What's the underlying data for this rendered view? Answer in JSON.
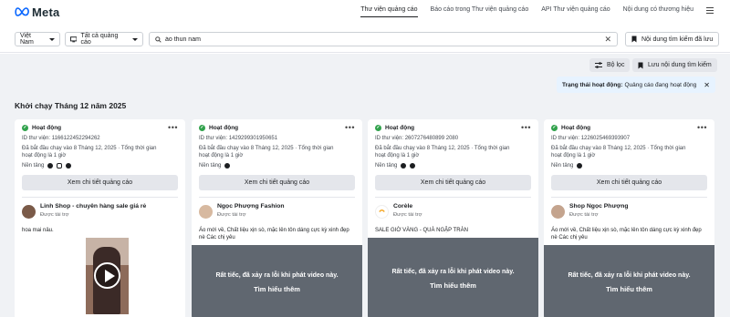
{
  "app": {
    "logo_text": "Meta"
  },
  "nav": {
    "links": [
      {
        "label": "Thư viện quảng cáo",
        "active": true
      },
      {
        "label": "Báo cáo trong Thư viện quảng cáo",
        "active": false
      },
      {
        "label": "API Thư viện quảng cáo",
        "active": false
      },
      {
        "label": "Nội dung có thương hiệu",
        "active": false
      }
    ]
  },
  "filters": {
    "country": "Việt Nam",
    "ad_category": "Tất cả quảng cáo",
    "search_value": "áo thun nam",
    "saved_searches_label": "Nội dung tìm kiếm đã lưu"
  },
  "toolbar": {
    "filter_label": "Bộ lọc",
    "save_search_label": "Lưu nội dung tìm kiếm"
  },
  "status_filter": {
    "label": "Trạng thái hoạt động:",
    "value": "Quảng cáo đang hoạt động"
  },
  "section_title": "Khởi chạy Tháng 12 năm 2025",
  "cards": [
    {
      "status": "Hoạt động",
      "library_id": "ID thư viện: 1166122452294262",
      "started": "Đã bắt đầu chạy vào 8 Tháng 12, 2025 · Tổng thời gian hoạt động là 1 giờ",
      "platforms_label": "Nền tảng",
      "detail_button": "Xem chi tiết quảng cáo",
      "advertiser": "Linh Shop - chuyên hàng sale giá rẻ",
      "sponsored": "Được tài trợ",
      "body": "hoa mai nâu."
    },
    {
      "status": "Hoạt động",
      "library_id": "ID thư viện: 1429299301950651",
      "started": "Đã bắt đầu chạy vào 8 Tháng 12, 2025 · Tổng thời gian hoạt động là 1 giờ",
      "platforms_label": "Nền tảng",
      "detail_button": "Xem chi tiết quảng cáo",
      "advertiser": "Ngọc Phượng Fashion",
      "sponsored": "Được tài trợ",
      "body": "Áo mới về, Chất liệu xịn sò, mặc lên tôn dáng cực kỳ xinh đẹp nè Các chị yêu",
      "error_message": "Rất tiếc, đã xảy ra lỗi khi phát video này.",
      "error_link": "Tìm hiểu thêm"
    },
    {
      "status": "Hoạt động",
      "library_id": "ID thư viện: 2607276480899 2080",
      "started": "Đã bắt đầu chạy vào 8 Tháng 12, 2025 · Tổng thời gian hoạt động là 1 giờ",
      "platforms_label": "Nền tảng",
      "detail_button": "Xem chi tiết quảng cáo",
      "advertiser": "Corèle",
      "sponsored": "Được tài trợ",
      "body": "SALE GIỜ VÀNG - QUÀ NGẬP TRÀN",
      "error_message": "Rất tiếc, đã xảy ra lỗi khi phát video này.",
      "error_link": "Tìm hiểu thêm"
    },
    {
      "status": "Hoạt động",
      "library_id": "ID thư viện: 1226025469393907",
      "started": "Đã bắt đầu chạy vào 8 Tháng 12, 2025 · Tổng thời gian hoạt động là 1 giờ",
      "platforms_label": "Nền tảng",
      "detail_button": "Xem chi tiết quảng cáo",
      "advertiser": "Shop Ngọc Phượng",
      "sponsored": "Được tài trợ",
      "body": "Áo mới về, Chất liệu xịn sò, mặc lên tôn dáng cực kỳ xinh đẹp nè Các chị yêu",
      "error_message": "Rất tiếc, đã xảy ra lỗi khi phát video này.",
      "error_link": "Tìm hiểu thêm"
    }
  ],
  "colors": {
    "active_green": "#31a24c",
    "meta_blue": "#0866ff",
    "page_bg": "#f0f2f5",
    "media_error_bg": "#606770"
  }
}
